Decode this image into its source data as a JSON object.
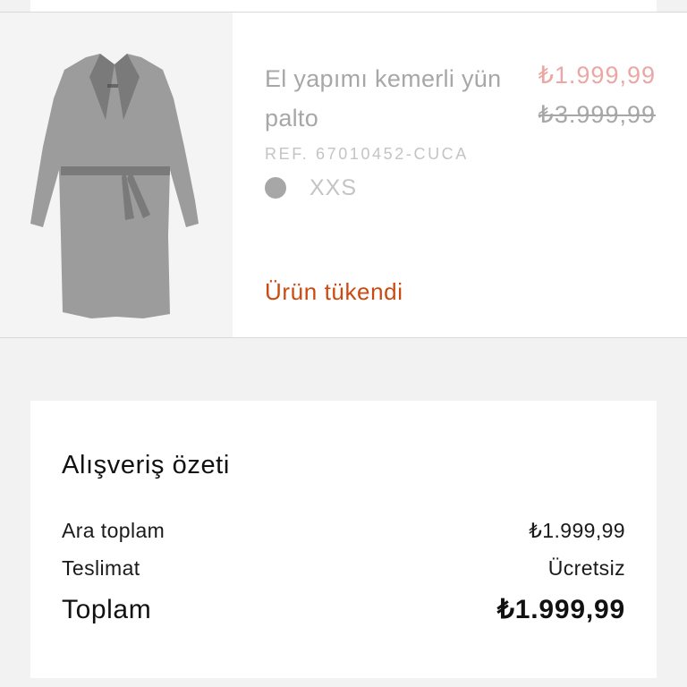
{
  "product": {
    "name": "El yapımı kemerli yün palto",
    "price_sale": "₺1.999,99",
    "price_original": "₺3.999,99",
    "ref": "REF. 67010452-CUCA",
    "color_swatch": "#a7a7a7",
    "size": "XXS",
    "status": "Ürün tükendi",
    "image_icon": "coat-image"
  },
  "summary": {
    "title": "Alışveriş özeti",
    "subtotal_label": "Ara toplam",
    "subtotal_value": "₺1.999,99",
    "shipping_label": "Teslimat",
    "shipping_value": "Ücretsiz",
    "total_label": "Toplam",
    "total_value": "₺1.999,99"
  },
  "colors": {
    "sale_price": "#eaa7a3",
    "status_text": "#cc4a10",
    "muted_text": "#a7a7a7",
    "background": "#f2f2f2"
  }
}
